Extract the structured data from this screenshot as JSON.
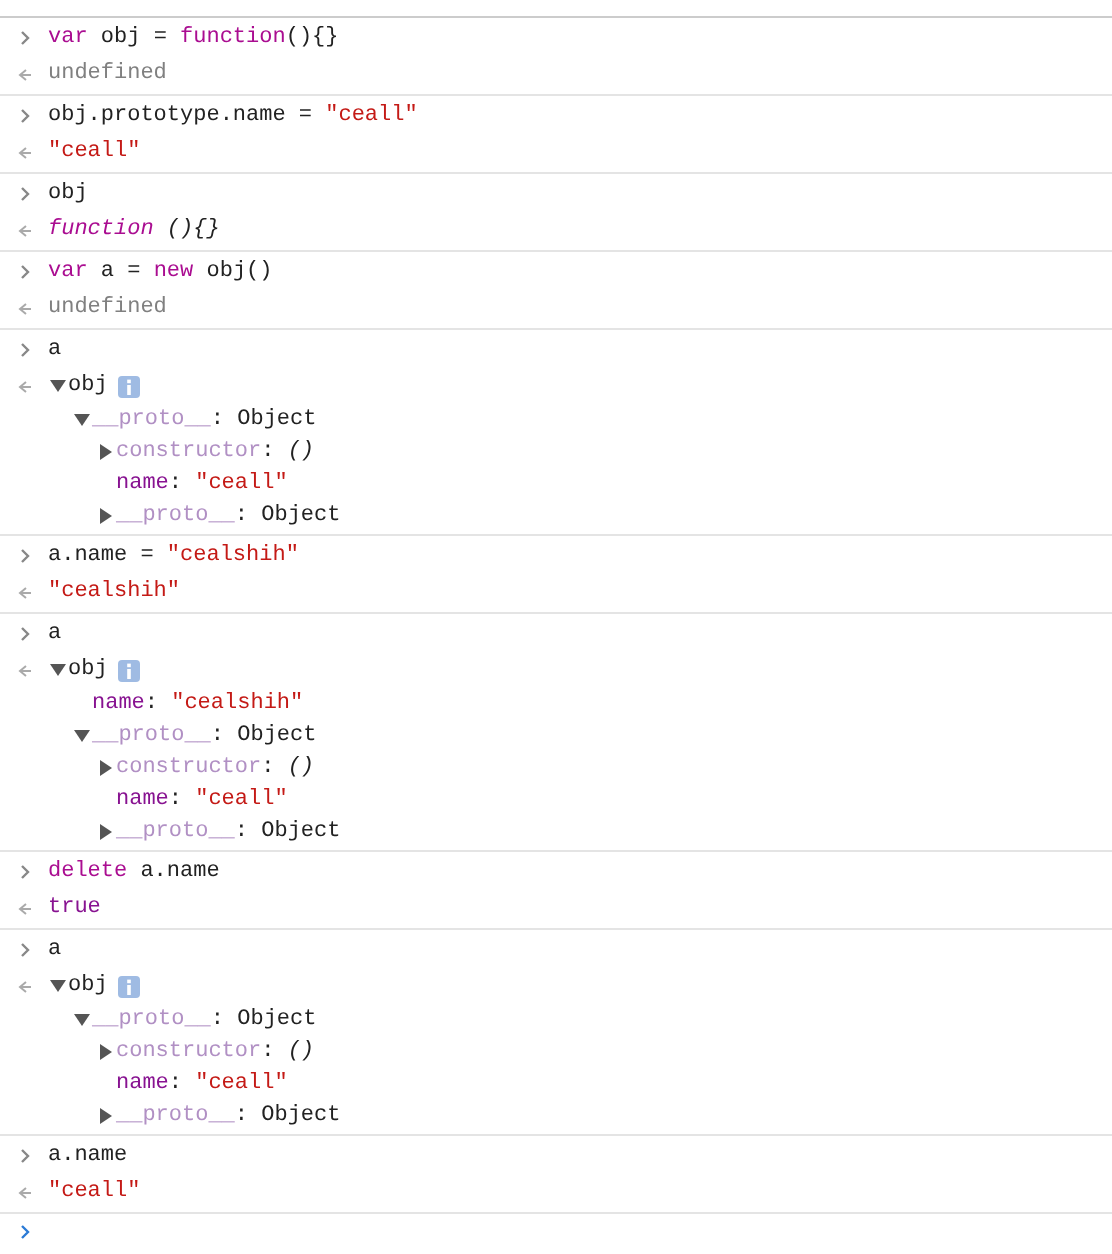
{
  "entries": [
    {
      "input": [
        {
          "text": "var",
          "kind": "kw"
        },
        {
          "text": " obj = ",
          "kind": "plain"
        },
        {
          "text": "function",
          "kind": "kw"
        },
        {
          "text": "(){}",
          "kind": "plain"
        }
      ],
      "output": {
        "kind": "value",
        "tokens": [
          {
            "text": "undefined",
            "kind": "undef"
          }
        ]
      }
    },
    {
      "input": [
        {
          "text": "obj.prototype.name = ",
          "kind": "plain"
        },
        {
          "text": "\"ceall\"",
          "kind": "str"
        }
      ],
      "output": {
        "kind": "value",
        "tokens": [
          {
            "text": "\"ceall\"",
            "kind": "str"
          }
        ]
      }
    },
    {
      "input": [
        {
          "text": "obj",
          "kind": "plain"
        }
      ],
      "output": {
        "kind": "value",
        "tokens": [
          {
            "text": "function",
            "kind": "fnitalic"
          },
          {
            "text": " (){}",
            "kind": "italic"
          }
        ]
      }
    },
    {
      "input": [
        {
          "text": "var",
          "kind": "kw"
        },
        {
          "text": " a = ",
          "kind": "plain"
        },
        {
          "text": "new",
          "kind": "kw"
        },
        {
          "text": " obj()",
          "kind": "plain"
        }
      ],
      "output": {
        "kind": "value",
        "tokens": [
          {
            "text": "undefined",
            "kind": "undef"
          }
        ]
      }
    },
    {
      "input": [
        {
          "text": "a",
          "kind": "plain"
        }
      ],
      "output": {
        "kind": "object",
        "expanded": true,
        "tokens": [
          {
            "text": "obj",
            "kind": "plain"
          }
        ],
        "children": [
          {
            "expanded": true,
            "tokens": [
              {
                "text": "__proto__",
                "kind": "dimprop"
              },
              {
                "text": ": Object",
                "kind": "plain"
              }
            ],
            "children": [
              {
                "expanded": false,
                "tokens": [
                  {
                    "text": "constructor",
                    "kind": "dimprop"
                  },
                  {
                    "text": ": ",
                    "kind": "plain"
                  },
                  {
                    "text": "()",
                    "kind": "italic"
                  }
                ]
              },
              {
                "tokens": [
                  {
                    "text": "name",
                    "kind": "prop"
                  },
                  {
                    "text": ": ",
                    "kind": "plain"
                  },
                  {
                    "text": "\"ceall\"",
                    "kind": "str"
                  }
                ]
              },
              {
                "expanded": false,
                "tokens": [
                  {
                    "text": "__proto__",
                    "kind": "dimprop"
                  },
                  {
                    "text": ": Object",
                    "kind": "plain"
                  }
                ]
              }
            ]
          }
        ]
      }
    },
    {
      "input": [
        {
          "text": "a.name = ",
          "kind": "plain"
        },
        {
          "text": "\"cealshih\"",
          "kind": "str"
        }
      ],
      "output": {
        "kind": "value",
        "tokens": [
          {
            "text": "\"cealshih\"",
            "kind": "str"
          }
        ]
      }
    },
    {
      "input": [
        {
          "text": "a",
          "kind": "plain"
        }
      ],
      "output": {
        "kind": "object",
        "expanded": true,
        "tokens": [
          {
            "text": "obj",
            "kind": "plain"
          }
        ],
        "children": [
          {
            "tokens": [
              {
                "text": "name",
                "kind": "prop"
              },
              {
                "text": ": ",
                "kind": "plain"
              },
              {
                "text": "\"cealshih\"",
                "kind": "str"
              }
            ]
          },
          {
            "expanded": true,
            "tokens": [
              {
                "text": "__proto__",
                "kind": "dimprop"
              },
              {
                "text": ": Object",
                "kind": "plain"
              }
            ],
            "children": [
              {
                "expanded": false,
                "tokens": [
                  {
                    "text": "constructor",
                    "kind": "dimprop"
                  },
                  {
                    "text": ": ",
                    "kind": "plain"
                  },
                  {
                    "text": "()",
                    "kind": "italic"
                  }
                ]
              },
              {
                "tokens": [
                  {
                    "text": "name",
                    "kind": "prop"
                  },
                  {
                    "text": ": ",
                    "kind": "plain"
                  },
                  {
                    "text": "\"ceall\"",
                    "kind": "str"
                  }
                ]
              },
              {
                "expanded": false,
                "tokens": [
                  {
                    "text": "__proto__",
                    "kind": "dimprop"
                  },
                  {
                    "text": ": Object",
                    "kind": "plain"
                  }
                ]
              }
            ]
          }
        ]
      }
    },
    {
      "input": [
        {
          "text": "delete",
          "kind": "kw"
        },
        {
          "text": " a.name",
          "kind": "plain"
        }
      ],
      "output": {
        "kind": "value",
        "tokens": [
          {
            "text": "true",
            "kind": "lit"
          }
        ]
      }
    },
    {
      "input": [
        {
          "text": "a",
          "kind": "plain"
        }
      ],
      "output": {
        "kind": "object",
        "expanded": true,
        "tokens": [
          {
            "text": "obj",
            "kind": "plain"
          }
        ],
        "children": [
          {
            "expanded": true,
            "tokens": [
              {
                "text": "__proto__",
                "kind": "dimprop"
              },
              {
                "text": ": Object",
                "kind": "plain"
              }
            ],
            "children": [
              {
                "expanded": false,
                "tokens": [
                  {
                    "text": "constructor",
                    "kind": "dimprop"
                  },
                  {
                    "text": ": ",
                    "kind": "plain"
                  },
                  {
                    "text": "()",
                    "kind": "italic"
                  }
                ]
              },
              {
                "tokens": [
                  {
                    "text": "name",
                    "kind": "prop"
                  },
                  {
                    "text": ": ",
                    "kind": "plain"
                  },
                  {
                    "text": "\"ceall\"",
                    "kind": "str"
                  }
                ]
              },
              {
                "expanded": false,
                "tokens": [
                  {
                    "text": "__proto__",
                    "kind": "dimprop"
                  },
                  {
                    "text": ": Object",
                    "kind": "plain"
                  }
                ]
              }
            ]
          }
        ]
      }
    },
    {
      "input": [
        {
          "text": "a.name",
          "kind": "plain"
        }
      ],
      "output": {
        "kind": "value",
        "tokens": [
          {
            "text": "\"ceall\"",
            "kind": "str"
          }
        ]
      }
    }
  ]
}
